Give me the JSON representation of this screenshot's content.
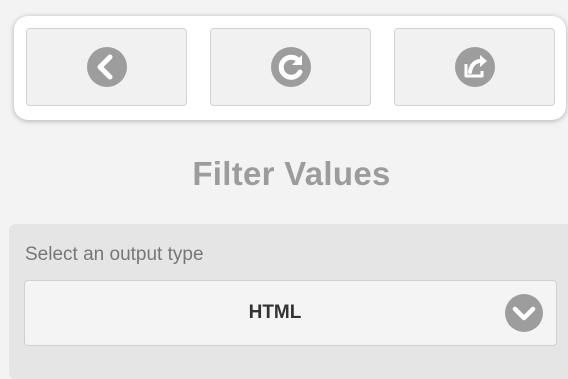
{
  "toolbar": {
    "buttons": [
      {
        "name": "back",
        "icon": "back-arrow-icon"
      },
      {
        "name": "refresh",
        "icon": "refresh-icon"
      },
      {
        "name": "share",
        "icon": "share-icon"
      }
    ]
  },
  "page": {
    "title": "Filter Values"
  },
  "filter": {
    "label": "Select an output type",
    "selected_value": "HTML",
    "dropdown_icon": "chevron-down-icon"
  },
  "colors": {
    "icon_gray": "#9d9d9d",
    "title_gray": "#9c9c9c",
    "panel_bg": "#e6e5e6"
  }
}
